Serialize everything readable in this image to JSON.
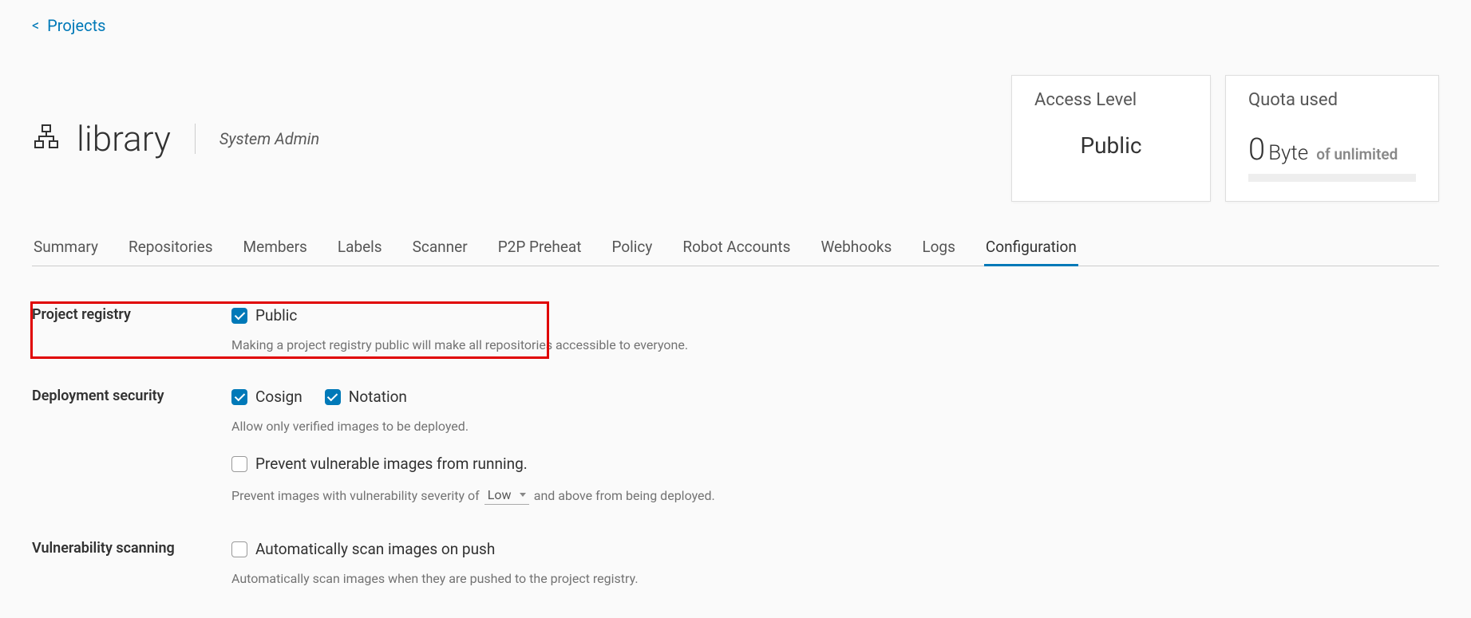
{
  "breadcrumb": {
    "back": "<",
    "link": "Projects"
  },
  "project": {
    "name": "library",
    "role": "System Admin"
  },
  "cards": {
    "access": {
      "title": "Access Level",
      "value": "Public"
    },
    "quota": {
      "title": "Quota used",
      "num": "0",
      "unit": "Byte",
      "of": "of unlimited"
    }
  },
  "tabs": [
    "Summary",
    "Repositories",
    "Members",
    "Labels",
    "Scanner",
    "P2P Preheat",
    "Policy",
    "Robot Accounts",
    "Webhooks",
    "Logs",
    "Configuration"
  ],
  "tab_active_index": 10,
  "config": {
    "registry": {
      "label": "Project registry",
      "checkbox": "Public",
      "help": "Making a project registry public will make all repositories accessible to everyone."
    },
    "deployment": {
      "label": "Deployment security",
      "cosign": "Cosign",
      "notation": "Notation",
      "help1": "Allow only verified images to be deployed.",
      "prevent": "Prevent vulnerable images from running.",
      "sev_pre": "Prevent images with vulnerability severity of",
      "sev_value": "Low",
      "sev_post": "and above from being deployed."
    },
    "scanning": {
      "label": "Vulnerability scanning",
      "checkbox": "Automatically scan images on push",
      "help": "Automatically scan images when they are pushed to the project registry."
    }
  }
}
